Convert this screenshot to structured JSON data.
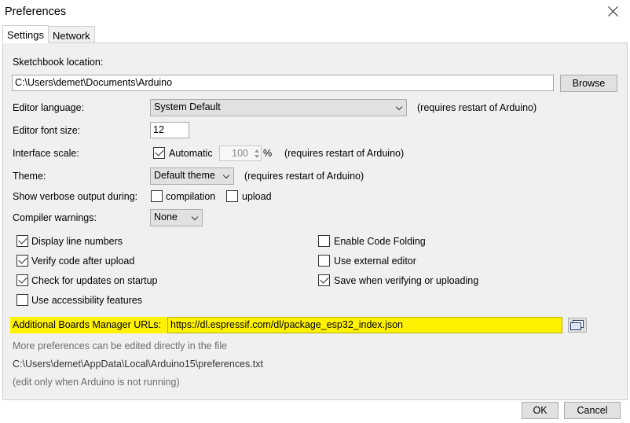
{
  "window": {
    "title": "Preferences"
  },
  "tabs": [
    {
      "label": "Settings"
    },
    {
      "label": "Network"
    }
  ],
  "settings": {
    "sketchbook": {
      "label": "Sketchbook location:",
      "value": "C:\\Users\\demet\\Documents\\Arduino",
      "browse_label": "Browse"
    },
    "editor_language": {
      "label": "Editor language:",
      "value": "System Default",
      "note": "(requires restart of Arduino)"
    },
    "font_size": {
      "label": "Editor font size:",
      "value": "12"
    },
    "interface_scale": {
      "label": "Interface scale:",
      "automatic_label": "Automatic",
      "automatic_checked": true,
      "value": "100",
      "unit": "%",
      "note": "(requires restart of Arduino)"
    },
    "theme": {
      "label": "Theme:",
      "value": "Default theme",
      "note": "(requires restart of Arduino)"
    },
    "verbose": {
      "label": "Show verbose output during:",
      "compilation_label": "compilation",
      "compilation_checked": false,
      "upload_label": "upload",
      "upload_checked": false
    },
    "compiler_warnings": {
      "label": "Compiler warnings:",
      "value": "None"
    },
    "checkboxes_left": [
      {
        "label": "Display line numbers",
        "checked": true
      },
      {
        "label": "Verify code after upload",
        "checked": true
      },
      {
        "label": "Check for updates on startup",
        "checked": true
      },
      {
        "label": "Use accessibility features",
        "checked": false
      }
    ],
    "checkboxes_right": [
      {
        "label": "Enable Code Folding",
        "checked": false
      },
      {
        "label": "Use external editor",
        "checked": false
      },
      {
        "label": "Save when verifying or uploading",
        "checked": true
      }
    ],
    "boards_manager": {
      "label": "Additional Boards Manager URLs:",
      "value": "https://dl.espressif.com/dl/package_esp32_index.json"
    },
    "footer": {
      "more_text": "More preferences can be edited directly in the file",
      "path": "C:\\Users\\demet\\AppData\\Local\\Arduino15\\preferences.txt",
      "edit_note": "(edit only when Arduino is not running)"
    }
  },
  "buttons": {
    "ok": "OK",
    "cancel": "Cancel"
  },
  "colors": {
    "highlight": "#fff200",
    "panel": "#f0f0f0"
  }
}
